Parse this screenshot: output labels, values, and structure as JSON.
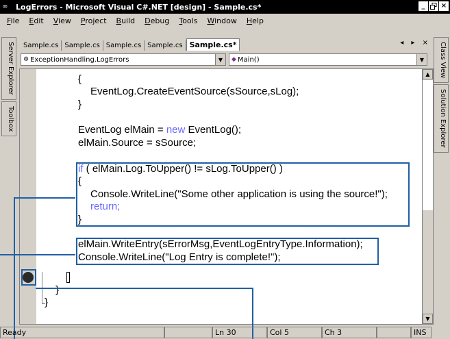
{
  "window": {
    "title": "LogErrors - Microsoft Visual C#.NET [design] - Sample.cs*",
    "buttons": [
      "_",
      " ",
      "×"
    ]
  },
  "menu": [
    {
      "u": "F",
      "rest": "ile"
    },
    {
      "u": "E",
      "rest": "dit"
    },
    {
      "u": "V",
      "rest": "iew"
    },
    {
      "u": "P",
      "rest": "roject"
    },
    {
      "u": "B",
      "rest": "uild"
    },
    {
      "u": "D",
      "rest": "ebug"
    },
    {
      "u": "T",
      "rest": "ools"
    },
    {
      "u": "W",
      "rest": "indow"
    },
    {
      "u": "H",
      "rest": "elp"
    }
  ],
  "left_panels": [
    "Server Explorer",
    "Toolbox"
  ],
  "right_panels": [
    "Class View",
    "Solution Explorer"
  ],
  "doc_tabs": [
    "Sample.cs",
    "Sample.cs",
    "Sample.cs",
    "Sample.cs",
    "Sample.cs*"
  ],
  "tab_controls": "◂ ▸ ×",
  "type_combo": "ExceptionHandling.LogErrors",
  "member_combo": "Main()",
  "code": {
    "l1": "{",
    "l2": "EventLog.CreateEventSource(sSource,sLog);",
    "l3": "}",
    "l4a": "EventLog elMain = ",
    "l4b": "new",
    "l4c": " EventLog();",
    "l5": "elMain.Source = sSource;",
    "l6a": "if",
    "l6b": " ( elMain.Log.ToUpper() != sLog.ToUpper() )",
    "l7": "{",
    "l8": "Console.WriteLine(\"Some other application is using the source!\");",
    "l9": "return;",
    "l10": "}",
    "l11": "elMain.WriteEntry(sErrorMsg,EventLogEntryType.Information);",
    "l12": "Console.WriteLine(\"Log Entry is complete!\");",
    "l13": "}",
    "l14": "}"
  },
  "status": {
    "ready": "Ready",
    "ln": "Ln 30",
    "col": "Col 5",
    "ch": "Ch 3",
    "ins": "INS"
  }
}
